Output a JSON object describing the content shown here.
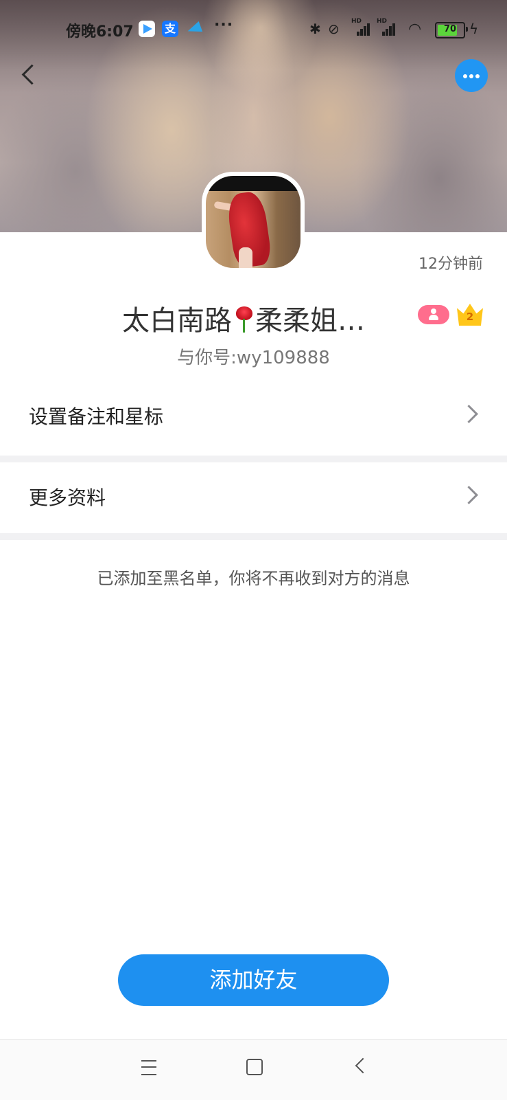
{
  "status_bar": {
    "time": "傍晚6:07",
    "more": "···",
    "battery": "70"
  },
  "profile": {
    "last_seen": "12分钟前",
    "name_part1": "太白南路",
    "name_part2": "柔柔姐…",
    "account": "与你号:wy109888",
    "level": "2"
  },
  "menu": {
    "remark_label": "设置备注和星标",
    "more_info_label": "更多资料"
  },
  "notice": "已添加至黑名单，你将不再收到对方的消息",
  "actions": {
    "add_friend": "添加好友"
  },
  "colors": {
    "accent": "#1e90f0",
    "badge_pink": "#ff6d8d",
    "crown_gold": "#ffc61a",
    "battery_green": "#5bd53b"
  },
  "icons": {
    "back": "chevron-left-icon",
    "more": "more-dots-icon",
    "row_arrow": "chevron-right-icon"
  }
}
